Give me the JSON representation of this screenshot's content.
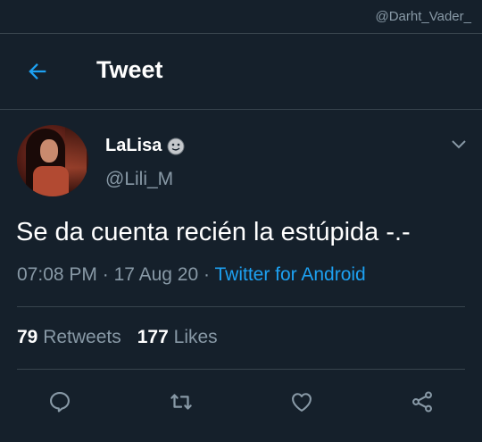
{
  "watermark": "@Darht_Vader_",
  "header": {
    "title": "Tweet"
  },
  "author": {
    "display_name": "LaLisa",
    "handle": "@Lili_M"
  },
  "tweet": {
    "text": "Se da cuenta recién la estúpida -.-",
    "time": "07:08 PM",
    "separator": "·",
    "date": "17 Aug 20",
    "source": "Twitter for Android"
  },
  "stats": {
    "retweets_count": "79",
    "retweets_label": "Retweets",
    "likes_count": "177",
    "likes_label": "Likes"
  },
  "icons": {
    "back": "arrow-left-icon",
    "chevron": "chevron-down-icon",
    "reply": "reply-icon",
    "retweet": "retweet-icon",
    "like": "heart-icon",
    "share": "share-icon",
    "badge": "smirk-emoji-icon"
  },
  "colors": {
    "background": "#15202b",
    "accent": "#1da1f2",
    "secondary_text": "#8899a6",
    "divider": "#38444d"
  }
}
